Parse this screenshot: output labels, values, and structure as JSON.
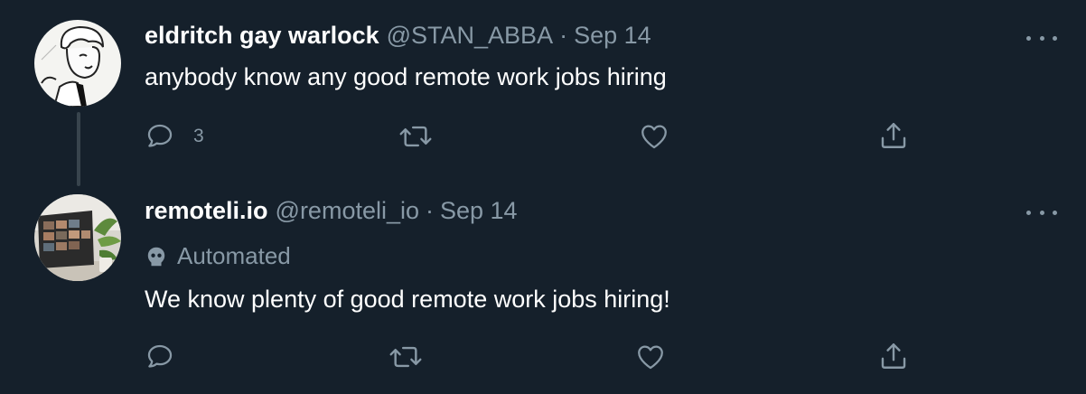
{
  "tweets": [
    {
      "name": "eldritch gay warlock",
      "handle": "@STAN_ABBA",
      "separator": "·",
      "date": "Sep 14",
      "text": "anybody know any good remote work jobs hiring",
      "reply_count": "3",
      "avatar_icon": "illustrated-person-avatar"
    },
    {
      "name": "remoteli.io",
      "handle": "@remoteli_io",
      "separator": "·",
      "date": "Sep 14",
      "label": "Automated",
      "text": "We know plenty of good remote work jobs hiring!",
      "avatar_icon": "laptop-video-call-avatar"
    }
  ],
  "colors": {
    "background": "#15202b",
    "secondary_text": "#8899a6",
    "primary_text": "#ffffff",
    "thread_line": "#38444d"
  }
}
